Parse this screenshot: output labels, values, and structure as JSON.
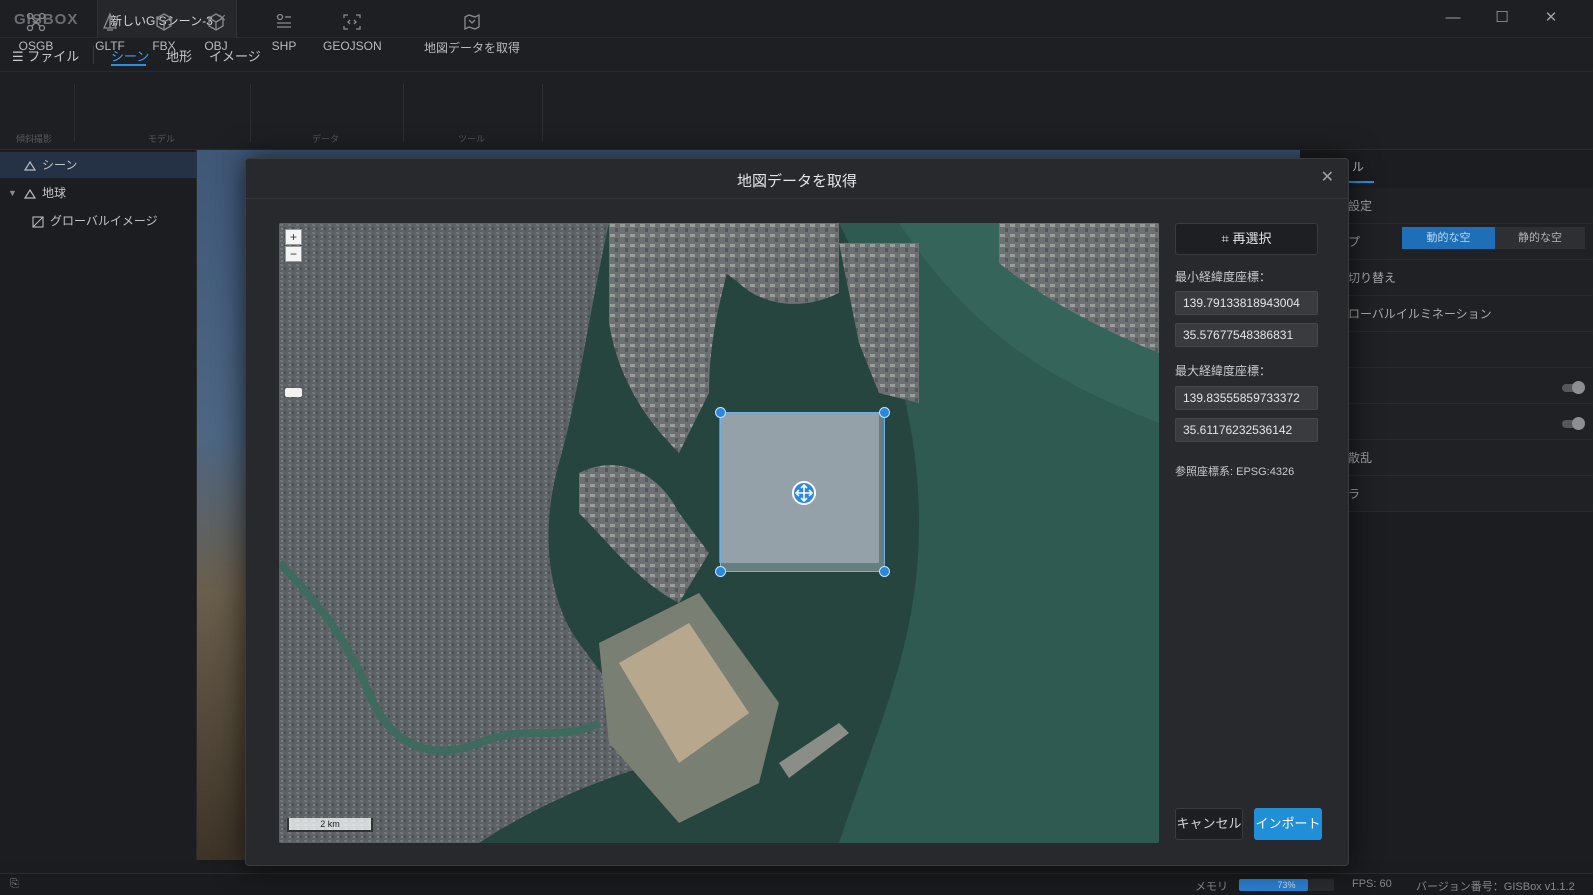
{
  "app": {
    "logo": "GISBOX",
    "tab_title": "新しいGISシーン-3",
    "tab_close": "×",
    "window_buttons": {
      "minimize": "—",
      "maximize": "☐",
      "close": "✕"
    }
  },
  "menu": {
    "file": "ファイル",
    "tabs": [
      "シーン",
      "地形",
      "イメージ"
    ],
    "active_tab": "シーン"
  },
  "toolbar": {
    "tools": [
      {
        "label": "OSGB",
        "icon": "drone-icon"
      },
      {
        "label": "GLTF",
        "icon": "bell-model-icon"
      },
      {
        "label": "FBX",
        "icon": "cube-wire-icon"
      },
      {
        "label": "OBJ",
        "icon": "cube-icon"
      },
      {
        "label": "SHP",
        "icon": "layers-icon"
      },
      {
        "label": "GEOJSON",
        "icon": "code-frame-icon"
      },
      {
        "label": "地図データを取得",
        "icon": "map-download-icon"
      }
    ],
    "groups": [
      "傾斜撮影",
      "モデル",
      "データ",
      "ツール"
    ]
  },
  "tree": {
    "items": [
      {
        "label": "シーン",
        "icon": "scene-icon"
      },
      {
        "label": "地球",
        "icon": "globe-icon"
      },
      {
        "label": "グローバルイメージ",
        "icon": "image-icon"
      }
    ]
  },
  "right_panel": {
    "tab": "ル",
    "rows": [
      "設定",
      "プ",
      "切り替え",
      "ローバルイルミネーション",
      "",
      "",
      "",
      "散乱",
      "ラ"
    ],
    "segment": [
      "動的な空",
      "静的な空"
    ],
    "segment_active": "動的な空"
  },
  "dialog": {
    "title": "地図データを取得",
    "close": "✕",
    "reselect_label": "再選択",
    "min_label": "最小経緯度座標：",
    "min_lon": "139.79133818943004",
    "min_lat": "35.57677548386831",
    "max_label": "最大経緯度座標：",
    "max_lon": "139.83555859733372",
    "max_lat": "35.61176232536142",
    "crs": "参照座標系: EPSG:4326",
    "cancel_label": "キャンセル",
    "import_label": "インポート",
    "map": {
      "zoom_in": "+",
      "zoom_out": "−",
      "scale_label": "2 km"
    }
  },
  "status": {
    "memory_label": "メモリ",
    "memory_percent": "73%",
    "memory_fraction": 0.73,
    "fps": "FPS: 60",
    "version": "バージョン番号：GISBox v1.1.2"
  },
  "colors": {
    "accent": "#2b8fe8",
    "import_button": "#1f8fd8",
    "selection_border": "#6fb0e6"
  }
}
